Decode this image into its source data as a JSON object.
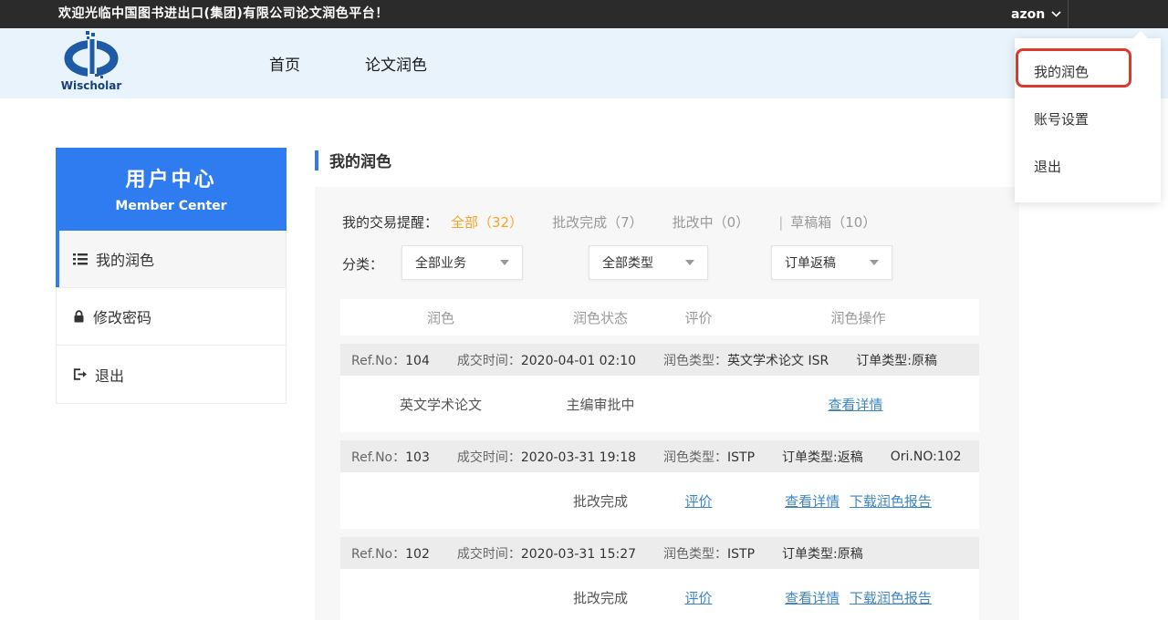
{
  "topbar": {
    "welcome": "欢迎光临中国图书进出口(集团)有限公司论文润色平台！",
    "username": "azon"
  },
  "header": {
    "logo": "Wischolar",
    "nav_home": "首页",
    "nav_polish": "论文润色"
  },
  "user_menu": {
    "item_my_polish": "我的润色",
    "item_account": "账号设置",
    "item_logout": "退出",
    "highlight_color": "#d93a2b"
  },
  "sidebar": {
    "title": "用户中心",
    "subtitle": "Member Center",
    "item_my_polish": "我的润色",
    "item_password": "修改密码",
    "item_logout": "退出",
    "accent_color": "#2f7bf0"
  },
  "main": {
    "page_title": "我的润色",
    "reminder": {
      "label": "我的交易提醒：",
      "tab_all": "全部（32）",
      "tab_done": "批改完成（7）",
      "tab_doing": "批改中（0）",
      "separator": "|",
      "tab_draft": "草稿箱（10）",
      "active_color": "#f5a429"
    },
    "filter": {
      "label": "分类：",
      "select_business": "全部业务",
      "select_type": "全部类型",
      "select_order": "订单返稿"
    },
    "table": {
      "headers": {
        "col1": "润色",
        "col2": "润色状态",
        "col3": "评价",
        "col4": "润色操作"
      },
      "rows": [
        {
          "ref_label": "Ref.No：",
          "ref_no": "104",
          "time_label": "成交时间：",
          "time": "2020-04-01 02:10",
          "type_label": "润色类型：",
          "type": "英文学术论文 ISR",
          "order_type": "订单类型:原稿",
          "ori_no": "",
          "name": "英文学术论文",
          "status": "主编审批中",
          "evaluate": "",
          "action1": "查看详情",
          "action2": ""
        },
        {
          "ref_label": "Ref.No：",
          "ref_no": "103",
          "time_label": "成交时间：",
          "time": "2020-03-31 19:18",
          "type_label": "润色类型：",
          "type": "ISTP",
          "order_type": "订单类型:返稿",
          "ori_no": "Ori.NO:102",
          "name": "",
          "status": "批改完成",
          "evaluate": "评价",
          "action1": "查看详情",
          "action2": "下载润色报告"
        },
        {
          "ref_label": "Ref.No：",
          "ref_no": "102",
          "time_label": "成交时间：",
          "time": "2020-03-31 15:27",
          "type_label": "润色类型：",
          "type": "ISTP",
          "order_type": "订单类型:原稿",
          "ori_no": "",
          "name": "",
          "status": "批改完成",
          "evaluate": "评价",
          "action1": "查看详情",
          "action2": "下载润色报告"
        }
      ]
    }
  }
}
